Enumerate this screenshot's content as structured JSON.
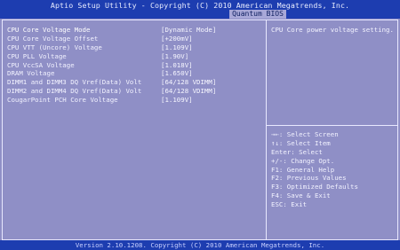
{
  "header": {
    "title": "Aptio Setup Utility - Copyright (C) 2010 American Megatrends, Inc.",
    "active_tab": "Quantum BIOS"
  },
  "settings": [
    {
      "label": "CPU Core Voltage Mode",
      "value": "[Dynamic Mode]"
    },
    {
      "label": "CPU Core Voltage Offset",
      "value": "[+200mV]"
    },
    {
      "label": "CPU VTT (Uncore) Voltage",
      "value": "[1.109V]"
    },
    {
      "label": "CPU PLL Voltage",
      "value": "[1.90V]"
    },
    {
      "label": "CPU VccSA Voltage",
      "value": "[1.018V]"
    },
    {
      "label": "DRAM Voltage",
      "value": "[1.650V]"
    },
    {
      "label": "DIMM1 and DIMM3 DQ Vref(Data) Volt",
      "value": "[64/128 VDIMM]"
    },
    {
      "label": "DIMM2 and DIMM4 DQ Vref(Data) Volt",
      "value": "[64/128 VDIMM]"
    },
    {
      "label": "CougarPoint PCH Core Voltage",
      "value": "[1.109V]"
    }
  ],
  "help_text": "CPU Core power voltage setting.",
  "key_help": [
    "→←: Select Screen",
    "↑↓: Select Item",
    "Enter: Select",
    "+/-: Change Opt.",
    "F1: General Help",
    "F2: Previous Values",
    "F3: Optimized Defaults",
    "F4: Save & Exit",
    "ESC: Exit"
  ],
  "footer": "Version 2.10.1208. Copyright (C) 2010 American Megatrends, Inc."
}
